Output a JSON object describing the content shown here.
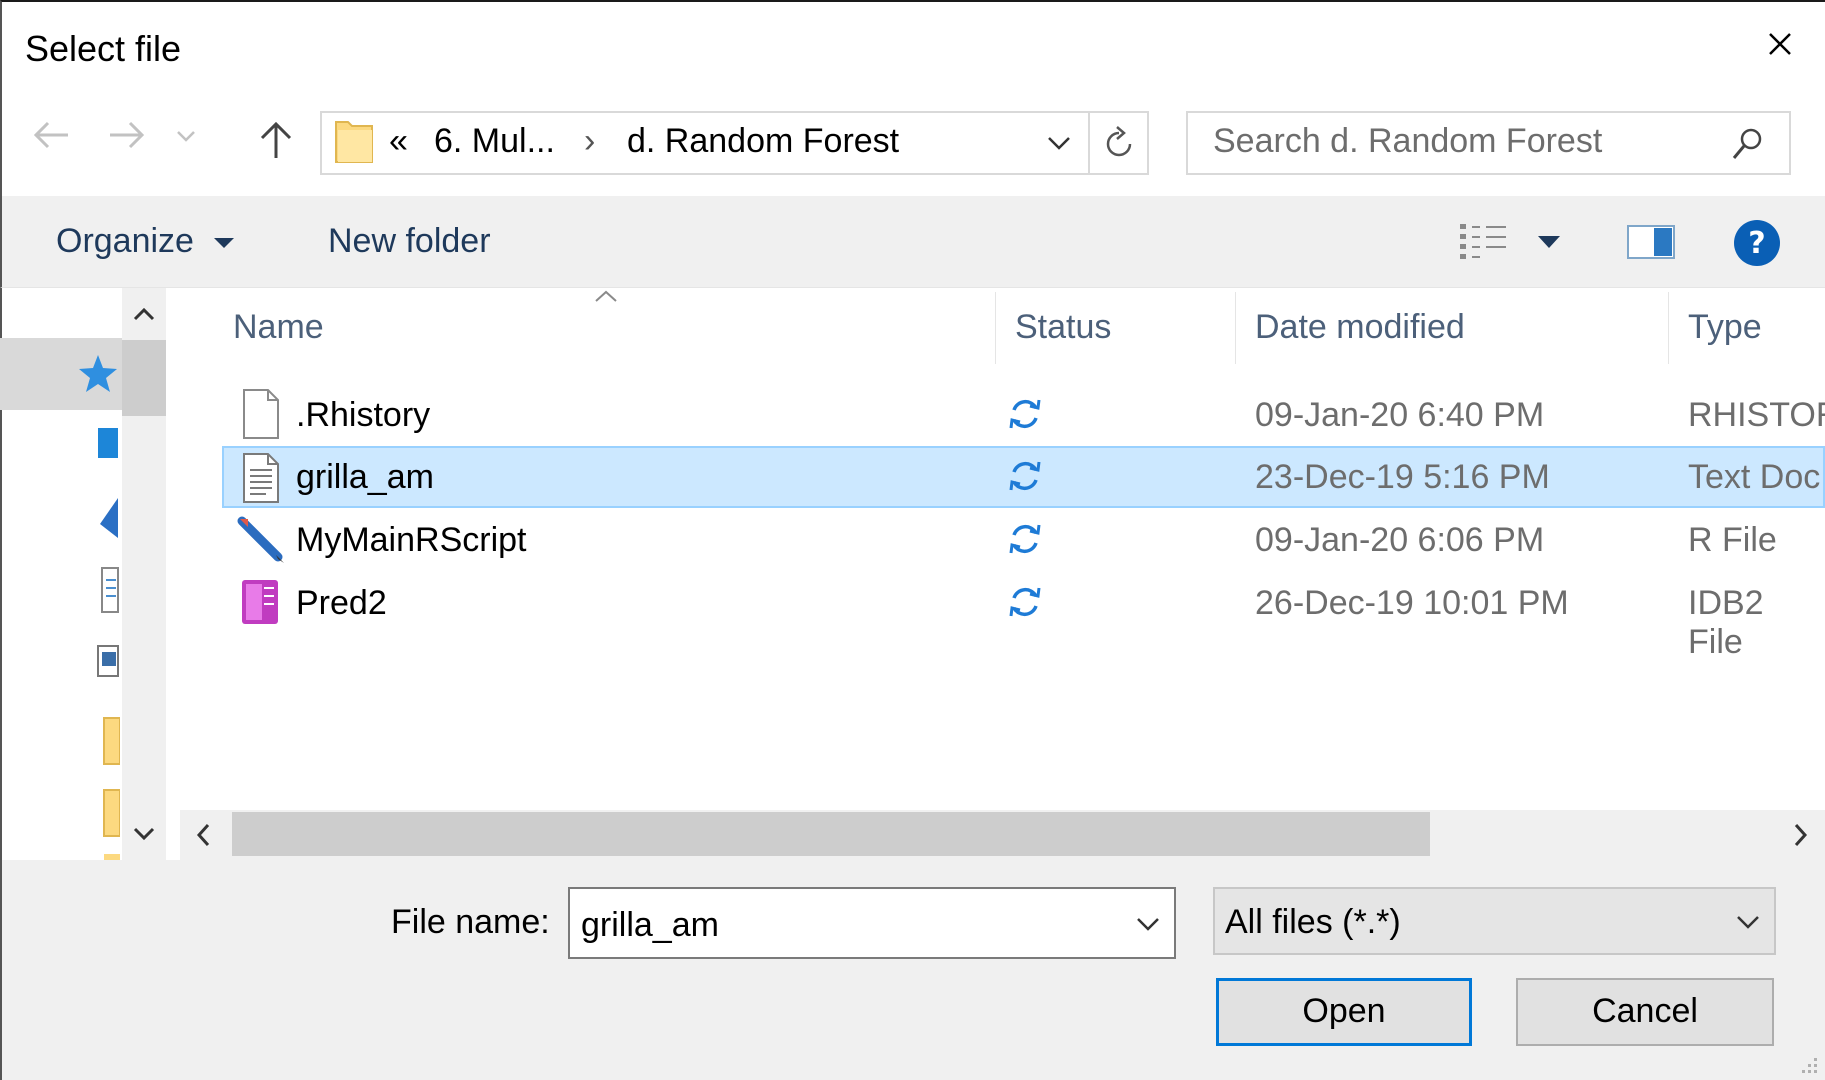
{
  "dialog": {
    "title": "Select file",
    "close_icon": "close-icon"
  },
  "navigation": {
    "back_icon": "arrow-left-icon",
    "forward_icon": "arrow-right-icon",
    "recent_icon": "chevron-down-icon",
    "up_icon": "arrow-up-icon",
    "breadcrumb": {
      "overflow": "«",
      "items": [
        "6. Mul...",
        "d. Random Forest"
      ],
      "separator": "›"
    },
    "refresh_icon": "refresh-icon",
    "search_placeholder": "Search d. Random Forest",
    "search_icon": "search-icon"
  },
  "toolbar": {
    "organize_label": "Organize",
    "new_folder_label": "New folder",
    "view_icon": "details-view-icon",
    "preview_pane_icon": "preview-pane-icon",
    "help_icon": "help-icon"
  },
  "file_list": {
    "columns": [
      "Name",
      "Status",
      "Date modified",
      "Type"
    ],
    "sort_column": "Name",
    "rows": [
      {
        "name": ".Rhistory",
        "date": "09-Jan-20 6:40 PM",
        "type": "RHISTORY",
        "icon": "blank-file-icon",
        "selected": false
      },
      {
        "name": "grilla_am",
        "date": "23-Dec-19 5:16 PM",
        "type": "Text Doc",
        "icon": "text-file-icon",
        "selected": true
      },
      {
        "name": "MyMainRScript",
        "date": "09-Jan-20 6:06 PM",
        "type": "R File",
        "icon": "r-script-icon",
        "selected": false
      },
      {
        "name": "Pred2",
        "date": "26-Dec-19 10:01 PM",
        "type": "IDB2 File",
        "icon": "idb2-file-icon",
        "selected": false
      }
    ],
    "status_icon": "sync-pending-icon"
  },
  "footer": {
    "file_name_label": "File name:",
    "file_name_value": "grilla_am",
    "file_type_value": "All files (*.*)",
    "open_label": "Open",
    "cancel_label": "Cancel"
  },
  "colors": {
    "selection_bg": "#cce8ff",
    "selection_border": "#99d1ff",
    "accent": "#0078d7",
    "sync_blue": "#1e7bd6"
  }
}
